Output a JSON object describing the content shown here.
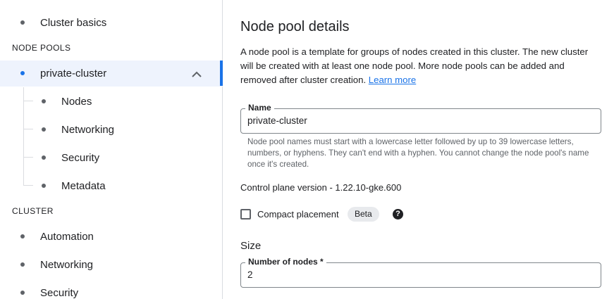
{
  "sidebar": {
    "top_item": "Cluster basics",
    "node_pools_header": "NODE POOLS",
    "active_pool": "private-cluster",
    "pool_children": [
      "Nodes",
      "Networking",
      "Security",
      "Metadata"
    ],
    "cluster_header": "CLUSTER",
    "cluster_items": [
      "Automation",
      "Networking",
      "Security"
    ]
  },
  "main": {
    "title": "Node pool details",
    "description": "A node pool is a template for groups of nodes created in this cluster. The new cluster will be created with at least one node pool. More node pools can be added and removed after cluster creation.",
    "learn_more": "Learn more",
    "name_field": {
      "label": "Name",
      "value": "private-cluster",
      "hint": "Node pool names must start with a lowercase letter followed by up to 39 lowercase letters, numbers, or hyphens. They can't end with a hyphen. You cannot change the node pool's name once it's created."
    },
    "control_plane_version": "Control plane version - 1.22.10-gke.600",
    "compact_placement": {
      "label": "Compact placement",
      "badge": "Beta",
      "checked": false,
      "help_icon": "help-circle-icon"
    },
    "size_header": "Size",
    "nodes_field": {
      "label": "Number of nodes *",
      "value": "2"
    }
  },
  "colors": {
    "accent": "#1a73e8",
    "active_bg": "#eef3fd",
    "border": "#dadce0"
  }
}
